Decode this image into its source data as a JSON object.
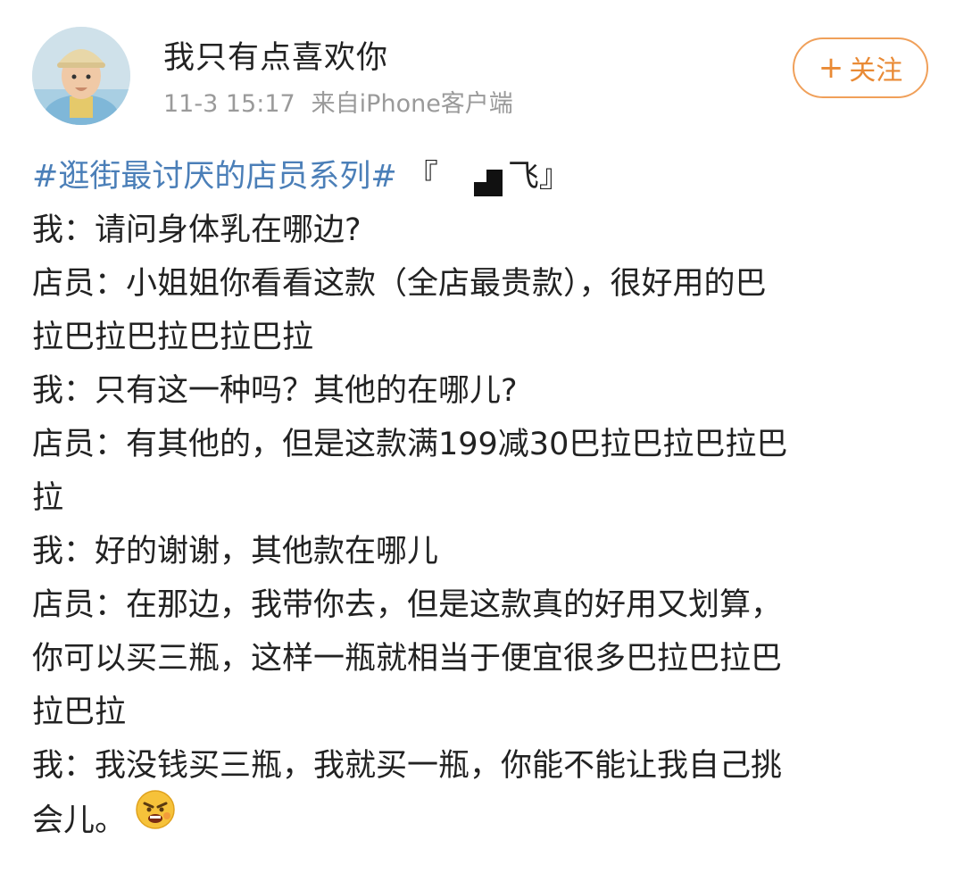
{
  "post": {
    "user": {
      "name": "我只有点喜欢你",
      "timestamp": "11-3 15:17",
      "source": "来自iPhone客户端"
    },
    "follow_button": {
      "plus": "+",
      "label": "关注"
    },
    "hashtag": "#逛街最讨厌的店员系列#",
    "hashtag_suffix_open": "『",
    "hashtag_suffix_close": "飞』",
    "lines": [
      "我：请问身体乳在哪边?",
      "店员：小姐姐你看看这款（全店最贵款），很好用的巴",
      "拉巴拉巴拉巴拉巴拉",
      "我：只有这一种吗？其他的在哪儿?",
      "店员：有其他的，但是这款满199减30巴拉巴拉巴拉巴",
      "拉",
      "我：好的谢谢，其他款在哪儿",
      "店员：在那边，我带你去，但是这款真的好用又划算，",
      "你可以买三瓶，这样一瓶就相当于便宜很多巴拉巴拉巴",
      "拉巴拉",
      "我：我没钱买三瓶，我就买一瓶，你能不能让我自己挑"
    ],
    "last_line": "会儿。",
    "emoji": "angry-emoji"
  }
}
